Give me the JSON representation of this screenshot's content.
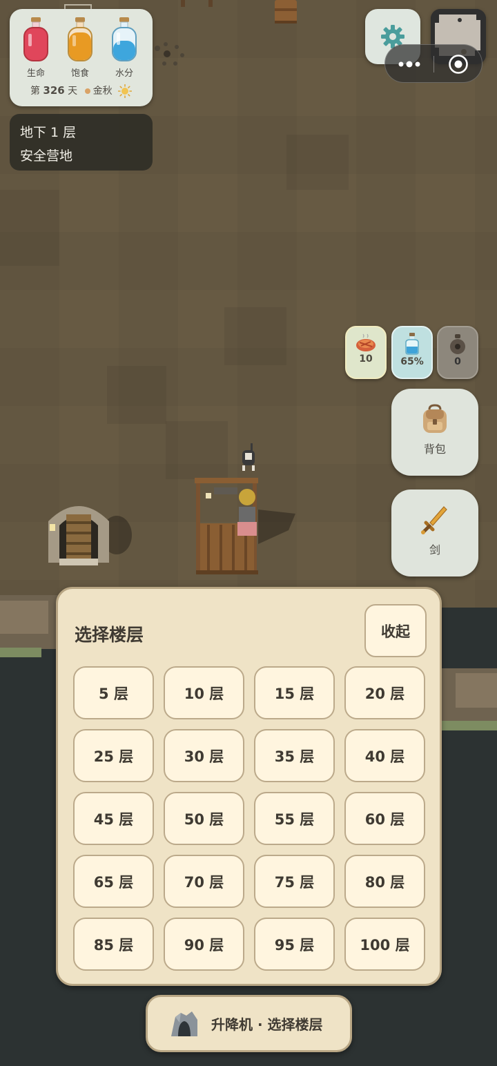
{
  "status": {
    "bottles": [
      {
        "label": "生命",
        "icon": "health-bottle-icon",
        "color": "#e0465b"
      },
      {
        "label": "饱食",
        "icon": "hunger-bottle-icon",
        "color": "#e89a23"
      },
      {
        "label": "水分",
        "icon": "water-bottle-icon",
        "color": "#3ea6dd"
      }
    ],
    "day_prefix": "第",
    "day_number": "326",
    "day_suffix": "天",
    "season": "金秋",
    "weather_icon": "sun-icon"
  },
  "location": {
    "floor": "地下 1 层",
    "area": "安全营地"
  },
  "quick_items": {
    "food": {
      "icon": "roasted-meat-icon",
      "value": "10"
    },
    "water": {
      "icon": "water-flask-icon",
      "value": "65%"
    },
    "pouch": {
      "icon": "pouch-icon",
      "value": "0"
    }
  },
  "buttons": {
    "backpack": "背包",
    "weapon": "剑"
  },
  "floor_panel": {
    "title": "选择楼层",
    "collapse": "收起",
    "floors": [
      "5 层",
      "10 层",
      "15 层",
      "20 层",
      "25 层",
      "30 层",
      "35 层",
      "40 层",
      "45 层",
      "50 层",
      "55 层",
      "60 层",
      "65 层",
      "70 层",
      "75 层",
      "80 层",
      "85 层",
      "90 层",
      "95 层",
      "100 层"
    ]
  },
  "elevator": {
    "label": "升降机 · 选择楼层",
    "icon": "cave-icon"
  }
}
